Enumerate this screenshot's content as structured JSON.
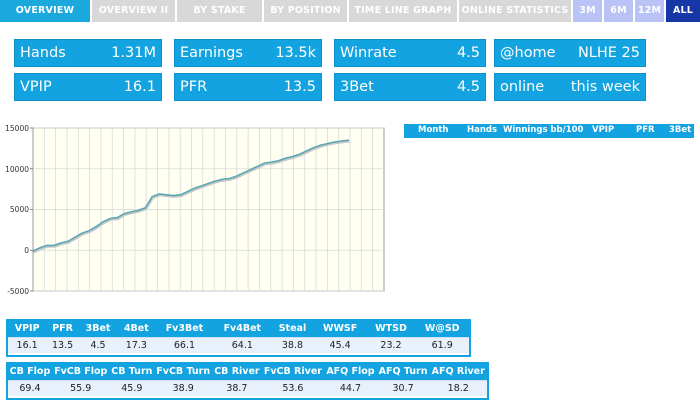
{
  "tabs": [
    {
      "label": "OVERVIEW",
      "state": "active"
    },
    {
      "label": "OVERVIEW II",
      "state": "inactive"
    },
    {
      "label": "BY STAKE",
      "state": "inactive"
    },
    {
      "label": "BY POSITION",
      "state": "inactive"
    },
    {
      "label": "TIME LINE GRAPH",
      "state": "inactive"
    },
    {
      "label": "ONLINE STATISTICS",
      "state": "inactive"
    },
    {
      "label": "3M",
      "state": "period"
    },
    {
      "label": "6M",
      "state": "period"
    },
    {
      "label": "12M",
      "state": "period"
    },
    {
      "label": "ALL",
      "state": "period-active"
    }
  ],
  "cards": {
    "hands": {
      "label": "Hands",
      "value": "1.31M"
    },
    "earnings": {
      "label": "Earnings",
      "value": "13.5k"
    },
    "winrate": {
      "label": "Winrate",
      "value": "4.5"
    },
    "home": {
      "label": "@home",
      "value": "NLHE 25"
    },
    "vpip": {
      "label": "VPIP",
      "value": "16.1"
    },
    "pfr": {
      "label": "PFR",
      "value": "13.5"
    },
    "threebet": {
      "label": "3Bet",
      "value": "4.5"
    },
    "online": {
      "label": "online",
      "value": "this week"
    }
  },
  "month_table": {
    "columns": [
      "Month",
      "Hands",
      "Winnings bb/100",
      "VPIP",
      "PFR",
      "3Bet"
    ]
  },
  "stats1": {
    "headers": [
      "VPIP",
      "PFR",
      "3Bet",
      "4Bet",
      "Fv3Bet",
      "Fv4Bet",
      "Steal",
      "WWSF",
      "WTSD",
      "W@SD"
    ],
    "values": [
      "16.1",
      "13.5",
      "4.5",
      "17.3",
      "66.1",
      "64.1",
      "38.8",
      "45.4",
      "23.2",
      "61.9"
    ]
  },
  "stats2": {
    "headers": [
      "CB Flop",
      "FvCB Flop",
      "CB Turn",
      "FvCB Turn",
      "CB River",
      "FvCB River",
      "AFQ Flop",
      "AFQ Turn",
      "AFQ River"
    ],
    "values": [
      "69.4",
      "55.9",
      "45.9",
      "38.9",
      "38.7",
      "53.6",
      "44.7",
      "30.7",
      "18.2"
    ]
  },
  "chart_data": {
    "type": "line",
    "title": "",
    "xlabel": "",
    "ylabel": "",
    "ylim": [
      -5000,
      15000
    ],
    "yticks": [
      "15000",
      "10000",
      "5000",
      "0",
      "-5000"
    ],
    "grid": true,
    "series": [
      {
        "color": "#5aa7b6",
        "x": [
          0,
          2,
          4,
          6,
          8,
          10,
          12,
          14,
          16,
          18,
          20,
          22,
          24,
          26,
          28,
          30,
          32,
          34,
          36,
          38,
          40,
          42,
          44,
          46,
          48,
          50,
          52,
          54,
          56,
          58,
          60,
          62,
          64,
          66,
          68,
          70,
          72,
          74,
          76,
          78,
          80,
          82,
          84,
          86,
          88,
          90,
          92,
          94,
          96,
          98,
          100
        ],
        "y": [
          -100,
          300,
          600,
          600,
          900,
          1100,
          1600,
          2100,
          2400,
          2900,
          3500,
          3900,
          4000,
          4500,
          4700,
          4900,
          5200,
          6600,
          6900,
          6800,
          6700,
          6800,
          7200,
          7600,
          7900,
          8200,
          8500,
          8700,
          8800,
          9100,
          9500,
          9900,
          10300,
          10700,
          10800,
          11000,
          11300,
          11500,
          11800,
          12200,
          12600,
          12900,
          13100,
          13300,
          13400,
          13500,
          13500,
          13500,
          13500,
          13500,
          13500
        ]
      }
    ]
  },
  "colors": {
    "accent": "#12a3e0",
    "tab_active": "#1ba8dc",
    "tab_period": "#b9c3f5",
    "tab_all": "#1538a6",
    "plot_bg": "#fffff2",
    "line": "#5aa7b6"
  }
}
